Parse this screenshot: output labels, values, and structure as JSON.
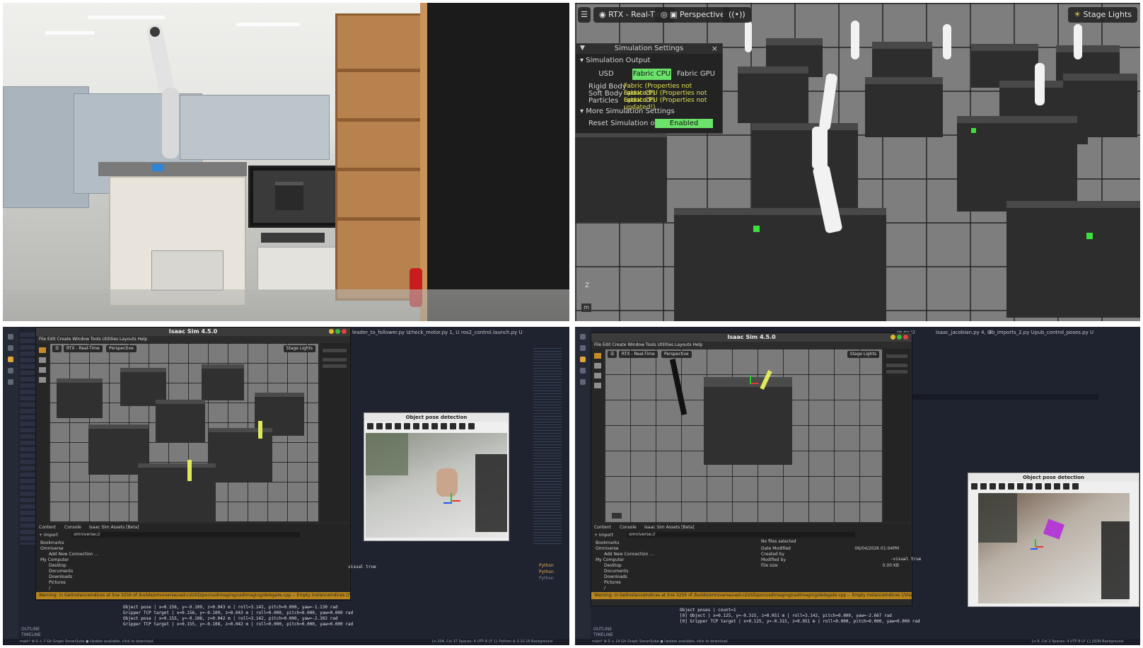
{
  "sim_viewport": {
    "renderer": "RTX - Real-Time",
    "camera": "Perspective",
    "lighting": "Stage Lights",
    "axis_label": "Z",
    "units_badge": "m"
  },
  "simulation_settings": {
    "title": "Simulation Settings",
    "close_glyph": "×",
    "output_section": "Simulation Output",
    "tabs": [
      "USD",
      "Fabric CPU",
      "Fabric GPU"
    ],
    "selected_tab": "Fabric CPU",
    "rows": [
      {
        "label": "Rigid Body",
        "value": "Fabric (Properties not updated!)"
      },
      {
        "label": "Soft Body",
        "value": "Fabric CPU (Properties not updated!)"
      },
      {
        "label": "Particles",
        "value": "Fabric CPU (Properties not updated!)"
      }
    ],
    "more_section": "More Simulation Settings",
    "reset_label": "Reset Simulation on Stop",
    "reset_value": "Enabled"
  },
  "desktop_left": {
    "window_title": "Isaac Sim 4.5.0",
    "menu": "File  Edit  Create  Window  Tools  Utilities  Layouts  Help",
    "editor_tabs": [
      "leader_to_follower.py  U",
      "check_motor.py  1, U",
      "ros2_control.launch.py  U"
    ],
    "content_tabs": [
      "Content",
      "Console",
      "Isaac Sim Assets [Beta]"
    ],
    "import_label": "+ Import",
    "path": "omniverse://",
    "tree": [
      "Bookmarks",
      "Omniverse",
      "Add New Connection ...",
      "My Computer",
      "Desktop",
      "Documents",
      "Downloads",
      "Pictures",
      "/"
    ],
    "warning": "Warning: in GetInstanceIndices at line 3256 of /builds/omniverse/usd-ci/USD/pxr/usdImaging/usdImaging/delegate.cpp -- Empty InstanceIndices (/Visuals/ee_current_/Visuals/o",
    "pose_title": "Object pose detection",
    "terminal": [
      "Object pose | x=0.156, y=-0.109, z=0.043 m | roll=3.142, pitch=0.000, yaw=-1.130 rad",
      "Gripper TCP target | x=0.156, y=-0.109, z=0.043 m | roll=0.000, pitch=0.000, yaw=0.000 rad",
      "Object pose | x=0.155, y=-0.108, z=0.042 m | roll=3.142, pitch=0.000, yaw=-2.302 rad",
      "Gripper TCP target | x=0.155, y=-0.108, z=0.042 m | roll=0.000, pitch=0.000, yaw=0.000 rad"
    ],
    "side_text": "visual true",
    "side_list": [
      "Python",
      "Python",
      "Python"
    ],
    "outline": "OUTLINE",
    "timeline": "TIMELINE",
    "status": "main*  ⊗ 0 ⚠ 7   Git Graph   SonarQube   ● Update available, click to download.",
    "status_right": "Ln 204, Col 37   Spaces: 4   UTF-8   LF   {} Python   ⊕ 3.10.16   Background"
  },
  "desktop_right": {
    "window_title": "Isaac Sim 4.5.0",
    "menu": "File  Edit  Create  Window  Tools  Utilities  Layouts  Help",
    "editor_tabs": [
      "re.py  U",
      "isaac_jacobian.py  4, U",
      "lib_imports_2.py  U",
      "pub_control_poses.py  U"
    ],
    "content_tabs": [
      "Content",
      "Console",
      "Isaac Sim Assets [Beta]"
    ],
    "import_label": "+ Import",
    "path": "omniverse://",
    "tree": [
      "Bookmarks",
      "Omniverse",
      "Add New Connection ...",
      "My Computer",
      "Desktop",
      "Documents",
      "Downloads",
      "Pictures",
      "/"
    ],
    "file_info": {
      "header": "No files selected",
      "date_label": "Date Modified",
      "date_value": "06/04/2026 01:04PM",
      "created_label": "Created by",
      "modified_label": "Modified by",
      "size_label": "File size",
      "size_value": "0.00 KB"
    },
    "warning": "Warning: in GetInstanceIndices at line 3256 of /builds/omniverse/usd-ci/USD/pxr/usdImaging/usdImaging/delegate.cpp -- Empty InstanceIndices (/Visuals/ee_current_/Visuals/o",
    "pose_title": "Object pose detection",
    "terminal": [
      "Object poses | count=1",
      "[0] Object | x=0.125, y=-0.315, z=0.051 m | roll=3.142, pitch=0.000, yaw=-2.667 rad",
      "[0] Gripper TCP target | x=0.125, y=-0.315, z=0.051 m | roll=0.000, pitch=0.000, yaw=0.000 rad"
    ],
    "side_text": "-visual true",
    "outline": "OUTLINE",
    "timeline": "TIMELINE",
    "status": "main*  ⊗ 0 ⚠ 14   Git Graph   SonarQube   ● Update available, click to download.",
    "status_right": "Ln 8, Col 2   Spaces: 4   UTF-8   LF   {} JSON   Background"
  },
  "colors": {
    "accent_green": "#6be36b",
    "warning_yellow": "#e0e050",
    "warning_bar": "#b8861b",
    "editor_bg": "#1f2330"
  }
}
